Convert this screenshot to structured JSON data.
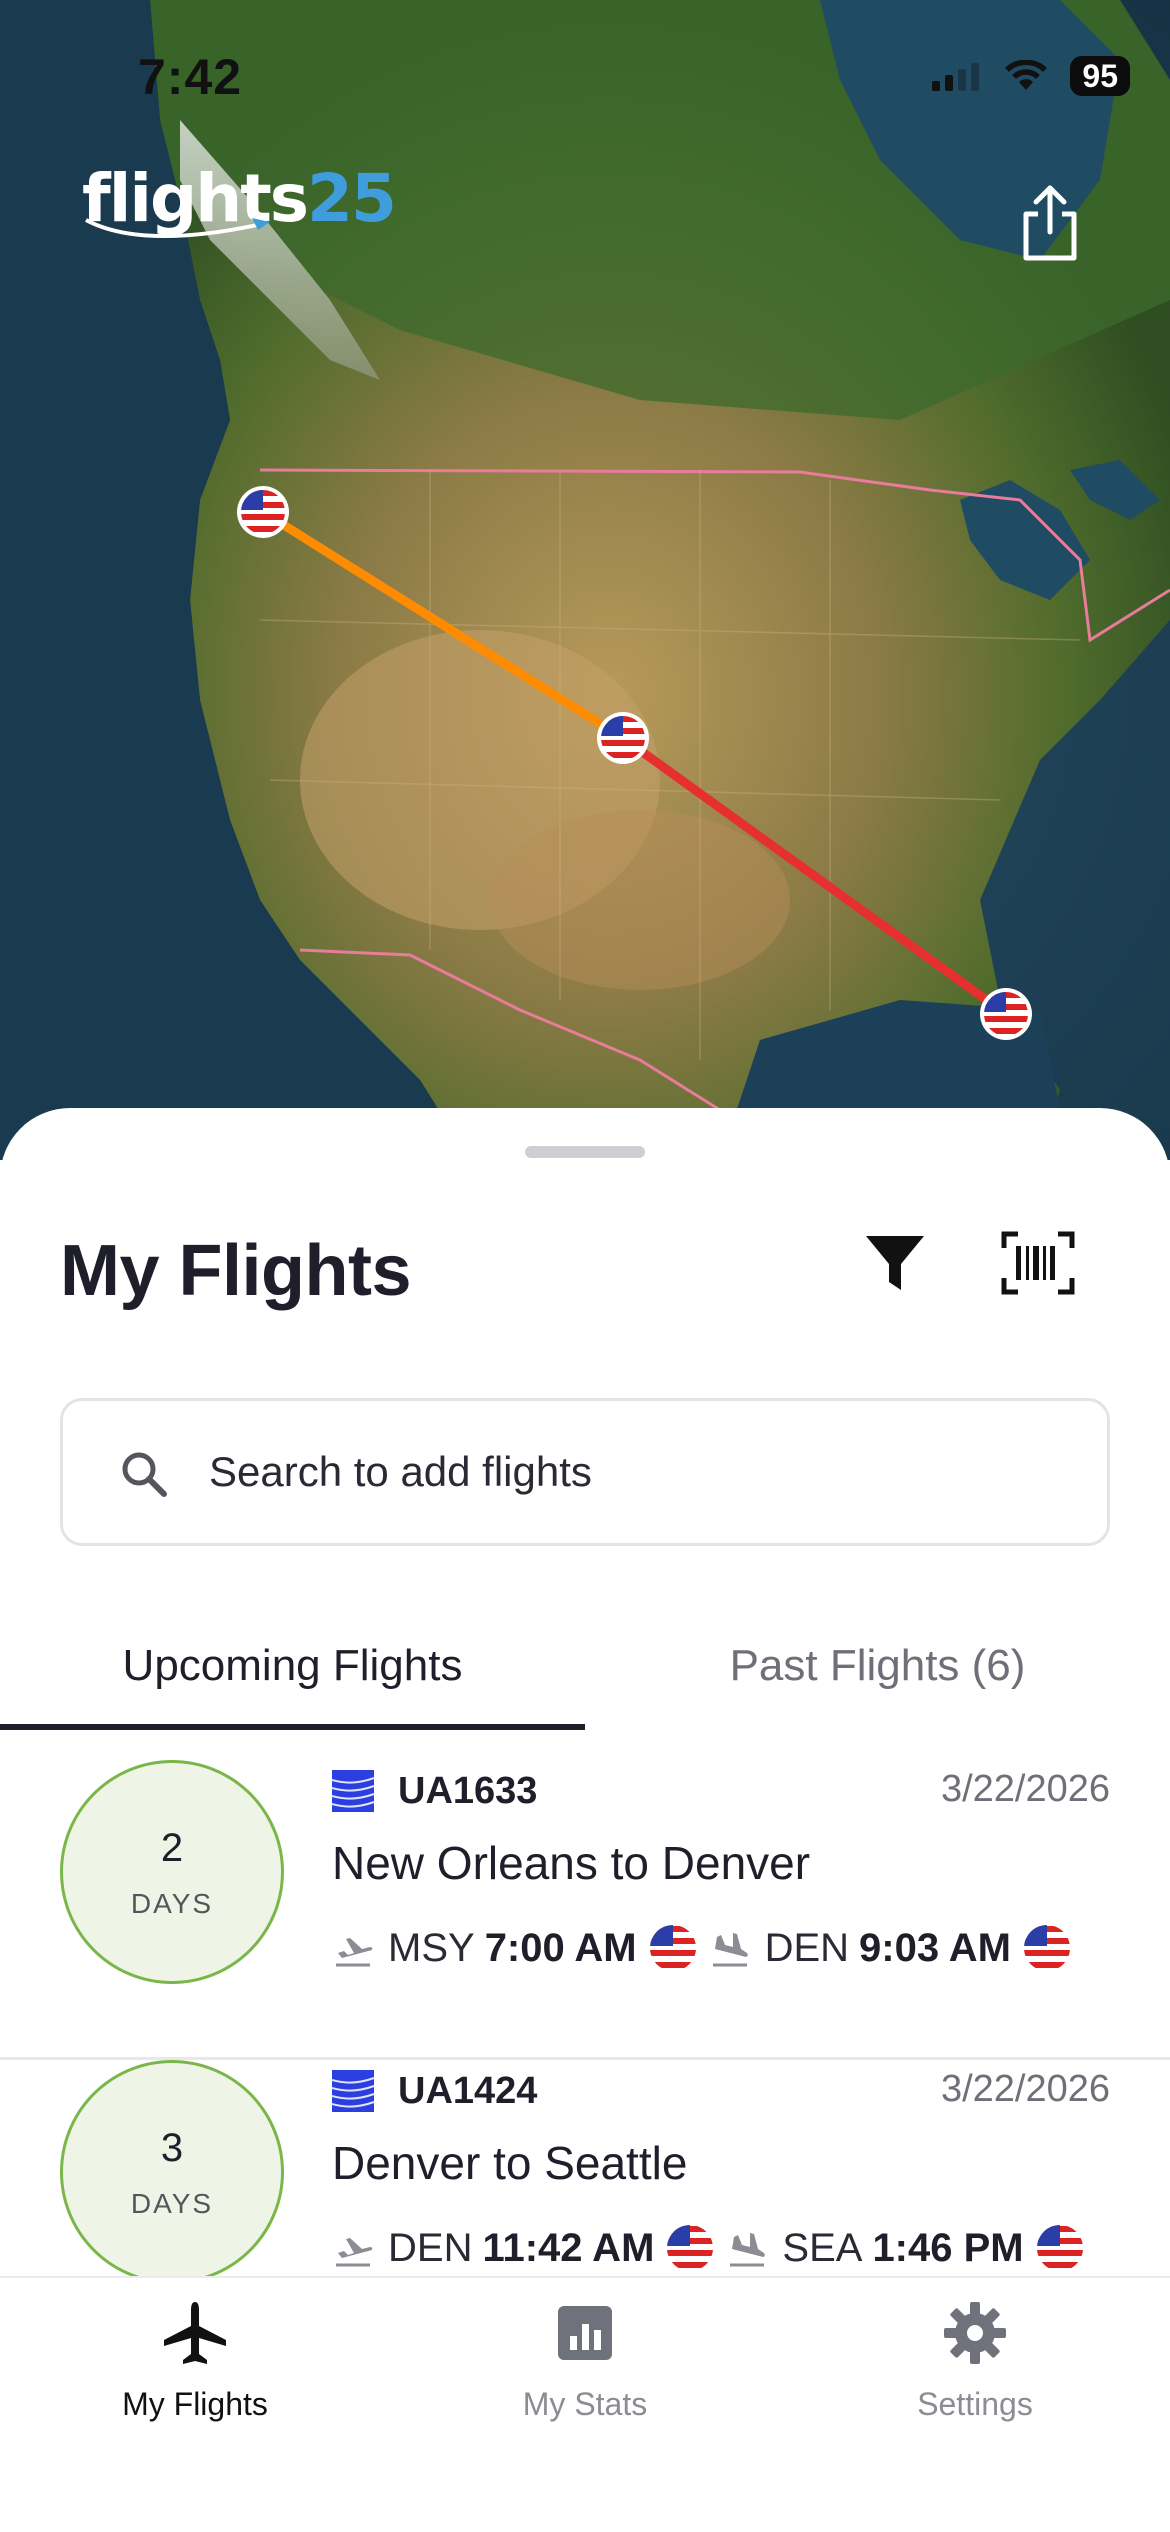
{
  "status_bar": {
    "time": "7:42",
    "battery": "95"
  },
  "app": {
    "logo_word": "flights",
    "logo_num": "25"
  },
  "sheet": {
    "title": "My Flights",
    "search_placeholder": "Search to add flights",
    "tabs": [
      {
        "label": "Upcoming Flights",
        "active": true
      },
      {
        "label": "Past Flights (6)",
        "active": false
      }
    ]
  },
  "flights": [
    {
      "days_count": "2",
      "days_label": "DAYS",
      "flight_number": "UA1633",
      "date": "3/22/2026",
      "route": "New Orleans to Denver",
      "dep_code": "MSY",
      "dep_time": "7:00 AM",
      "arr_code": "DEN",
      "arr_time": "9:03 AM"
    },
    {
      "days_count": "3",
      "days_label": "DAYS",
      "flight_number": "UA1424",
      "date": "3/22/2026",
      "route": "Denver to Seattle",
      "dep_code": "DEN",
      "dep_time": "11:42 AM",
      "arr_code": "SEA",
      "arr_time": "1:46 PM"
    }
  ],
  "tabbar": [
    {
      "label": "My Flights",
      "icon": "airplane-icon",
      "active": true
    },
    {
      "label": "My Stats",
      "icon": "stats-icon",
      "active": false
    },
    {
      "label": "Settings",
      "icon": "gear-icon",
      "active": false
    }
  ],
  "colors": {
    "accent_days_border": "#7ab648",
    "route_orange": "#ff8c00",
    "route_red": "#e63030",
    "airline_blue": "#2b3ee0"
  }
}
